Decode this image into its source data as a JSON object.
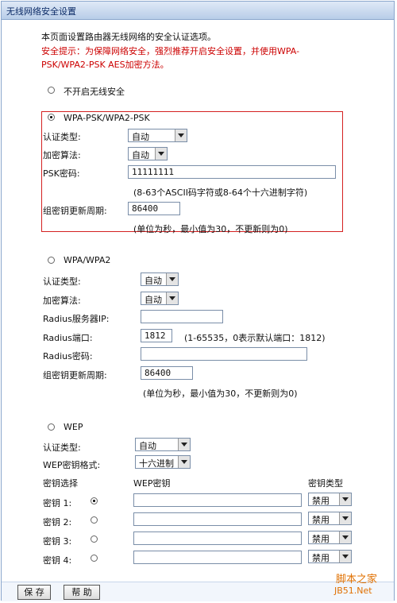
{
  "window": {
    "title": "无线网络安全设置"
  },
  "intro": {
    "line1": "本页面设置路由器无线网络的安全认证选项。",
    "warn1": "安全提示：为保障网络安全，强烈推荐开启安全设置，并使用WPA-",
    "warn2": "PSK/WPA2-PSK AES加密方法。"
  },
  "no_security": {
    "label": "不开启无线安全",
    "selected": false
  },
  "wpa_psk": {
    "label": "WPA-PSK/WPA2-PSK",
    "selected": true,
    "auth_label": "认证类型:",
    "auth_value": "自动",
    "enc_label": "加密算法:",
    "enc_value": "自动",
    "psk_label": "PSK密码:",
    "psk_value": "11111111",
    "psk_hint": "(8-63个ASCII码字符或8-64个十六进制字符)",
    "renew_label": "组密钥更新周期:",
    "renew_value": "86400",
    "renew_hint": "(单位为秒，最小值为30，不更新则为0)"
  },
  "wpa": {
    "label": "WPA/WPA2",
    "selected": false,
    "auth_label": "认证类型:",
    "auth_value": "自动",
    "enc_label": "加密算法:",
    "enc_value": "自动",
    "radius_ip_label": "Radius服务器IP:",
    "radius_ip_value": "",
    "radius_port_label": "Radius端口:",
    "radius_port_value": "1812",
    "radius_port_hint": "(1-65535，0表示默认端口：1812)",
    "radius_pwd_label": "Radius密码:",
    "radius_pwd_value": "",
    "renew_label": "组密钥更新周期:",
    "renew_value": "86400",
    "renew_hint": "(单位为秒，最小值为30，不更新则为0)"
  },
  "wep": {
    "label": "WEP",
    "selected": false,
    "auth_label": "认证类型:",
    "auth_value": "自动",
    "format_label": "WEP密钥格式:",
    "format_value": "十六进制",
    "col_select": "密钥选择",
    "col_key": "WEP密钥",
    "col_type": "密钥类型",
    "keys": [
      {
        "label": "密钥 1:",
        "value": "",
        "type": "禁用",
        "selected": true
      },
      {
        "label": "密钥 2:",
        "value": "",
        "type": "禁用",
        "selected": false
      },
      {
        "label": "密钥 3:",
        "value": "",
        "type": "禁用",
        "selected": false
      },
      {
        "label": "密钥 4:",
        "value": "",
        "type": "禁用",
        "selected": false
      }
    ]
  },
  "buttons": {
    "save": "保 存",
    "help": "帮 助"
  },
  "watermark": {
    "line1": "脚本之家",
    "line2": "JB51.Net"
  }
}
